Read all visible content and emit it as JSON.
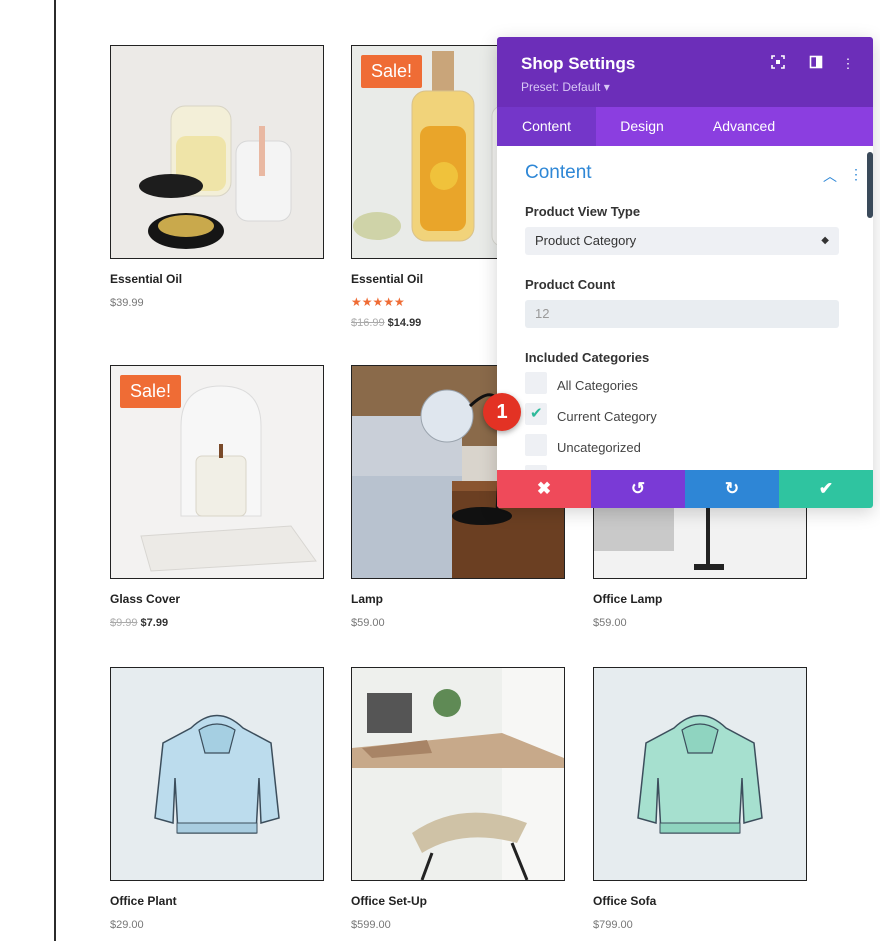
{
  "products": [
    {
      "name": "Essential Oil",
      "price": "$39.99"
    },
    {
      "name": "Essential Oil",
      "sale_badge": "Sale!",
      "rating": "★★★★★",
      "old_price": "$16.99",
      "new_price": "$14.99"
    },
    {
      "name": "Glass Cover",
      "sale_badge": "Sale!",
      "old_price": "$9.99",
      "new_price": "$7.99"
    },
    {
      "name": "Lamp",
      "price": "$59.00"
    },
    {
      "name": "Office Lamp",
      "price": "$59.00"
    },
    {
      "name": "Office Plant",
      "price": "$29.00"
    },
    {
      "name": "Office Set-Up",
      "price": "$599.00"
    },
    {
      "name": "Office Sofa",
      "price": "$799.00"
    }
  ],
  "panel": {
    "title": "Shop Settings",
    "preset": "Preset: Default ▾",
    "icons": {
      "expand": "fullscreen-icon",
      "layout": "split-view-icon",
      "more": "more-vertical-icon"
    },
    "tabs": [
      {
        "label": "Content",
        "active": true
      },
      {
        "label": "Design"
      },
      {
        "label": "Advanced"
      }
    ],
    "section": {
      "title": "Content",
      "product_view_type": {
        "label": "Product View Type",
        "value": "Product Category"
      },
      "product_count": {
        "label": "Product Count",
        "placeholder": "12"
      },
      "included_categories": {
        "label": "Included Categories",
        "options": [
          {
            "label": "All Categories",
            "checked": false
          },
          {
            "label": "Current Category",
            "checked": true
          },
          {
            "label": "Uncategorized",
            "checked": false
          }
        ]
      }
    },
    "footer": {
      "cancel": "✖",
      "undo": "↺",
      "redo": "↻",
      "save": "✔",
      "colors": {
        "cancel": "#ef4a5a",
        "undo": "#7a3ad6",
        "redo": "#2e86d6",
        "save": "#2fc4a0"
      }
    }
  },
  "callout": {
    "number": "1"
  }
}
